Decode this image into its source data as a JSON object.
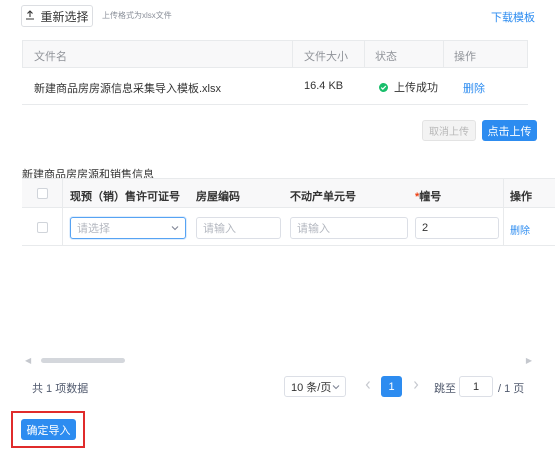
{
  "upload": {
    "reselect_label": "重新选择",
    "hint": "上传格式为xlsx文件",
    "download_template_label": "下载模板"
  },
  "file_table": {
    "headers": {
      "name": "文件名",
      "size": "文件大小",
      "status": "状态",
      "action": "操作"
    },
    "row": {
      "name": "新建商品房房源信息采集导入模板.xlsx",
      "size": "16.4 KB",
      "status": "上传成功",
      "action": "删除"
    }
  },
  "upload_actions": {
    "cancel_label": "取消上传",
    "upload_label": "点击上传"
  },
  "section_title": "新建商品房房源和销售信息",
  "house_table": {
    "headers": {
      "permit": "现预（销）售许可证号",
      "house_code": "房屋编码",
      "property_unit": "不动产单元号",
      "required_mark": "*",
      "building_no": "幢号",
      "action": "操作"
    },
    "row": {
      "permit_placeholder": "请选择",
      "house_code_placeholder": "请输入",
      "property_unit_placeholder": "请输入",
      "building_no": "2",
      "action": "删除"
    }
  },
  "pagination": {
    "total": "共 1 项数据",
    "page_size": "10 条/页",
    "current_page": "1",
    "goto_label": "跳至",
    "goto_value": "1",
    "total_pages": "/ 1 页"
  },
  "confirm_label": "确定导入",
  "colors": {
    "primary": "#2d8cf0",
    "link": "#2d8cf0",
    "success": "#19be6b",
    "required": "#ed4014",
    "highlight_border": "#e02b2b",
    "header_bg": "#f8f8f9"
  }
}
